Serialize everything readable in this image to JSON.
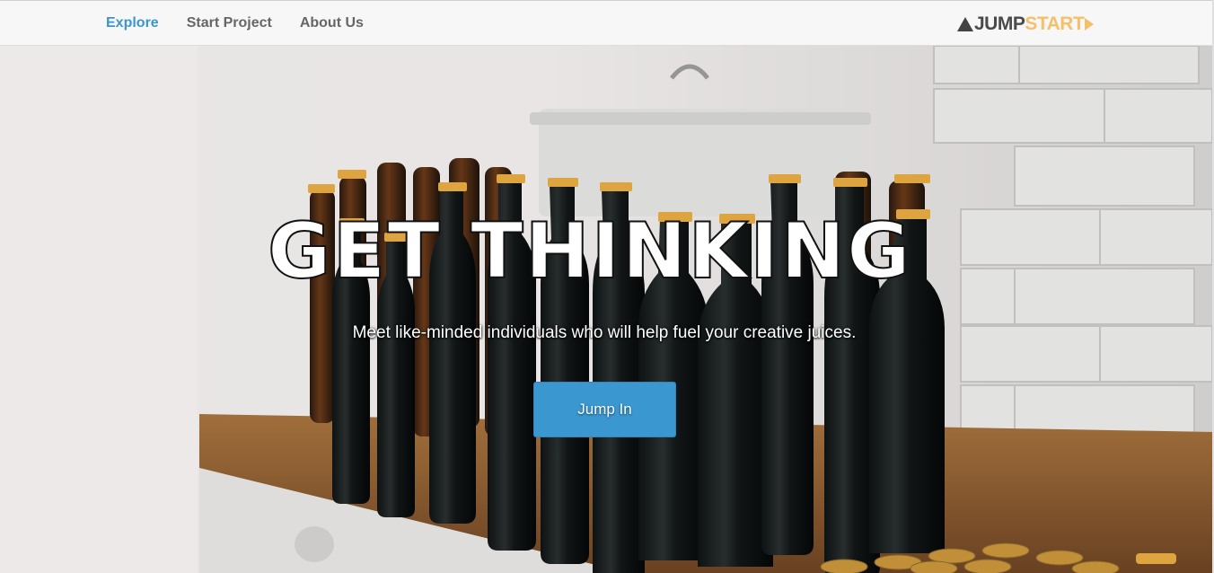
{
  "nav": {
    "links": [
      {
        "label": "Explore",
        "active": true
      },
      {
        "label": "Start Project",
        "active": false
      },
      {
        "label": "About Us",
        "active": false
      }
    ]
  },
  "logo": {
    "part_dark": "JUMP",
    "part_light": "START",
    "colors": {
      "dark": "#4a4a4a",
      "light": "#f5c06a"
    }
  },
  "hero": {
    "title": "GET THINKING",
    "subtitle": "Meet like-minded individuals who will help fuel your creative juices.",
    "button_label": "Jump In",
    "background_description_icon": "beer-bottles-photo"
  },
  "colors": {
    "accent": "#3a97cd",
    "button": "#3a97d0",
    "nav_text": "#666666"
  }
}
